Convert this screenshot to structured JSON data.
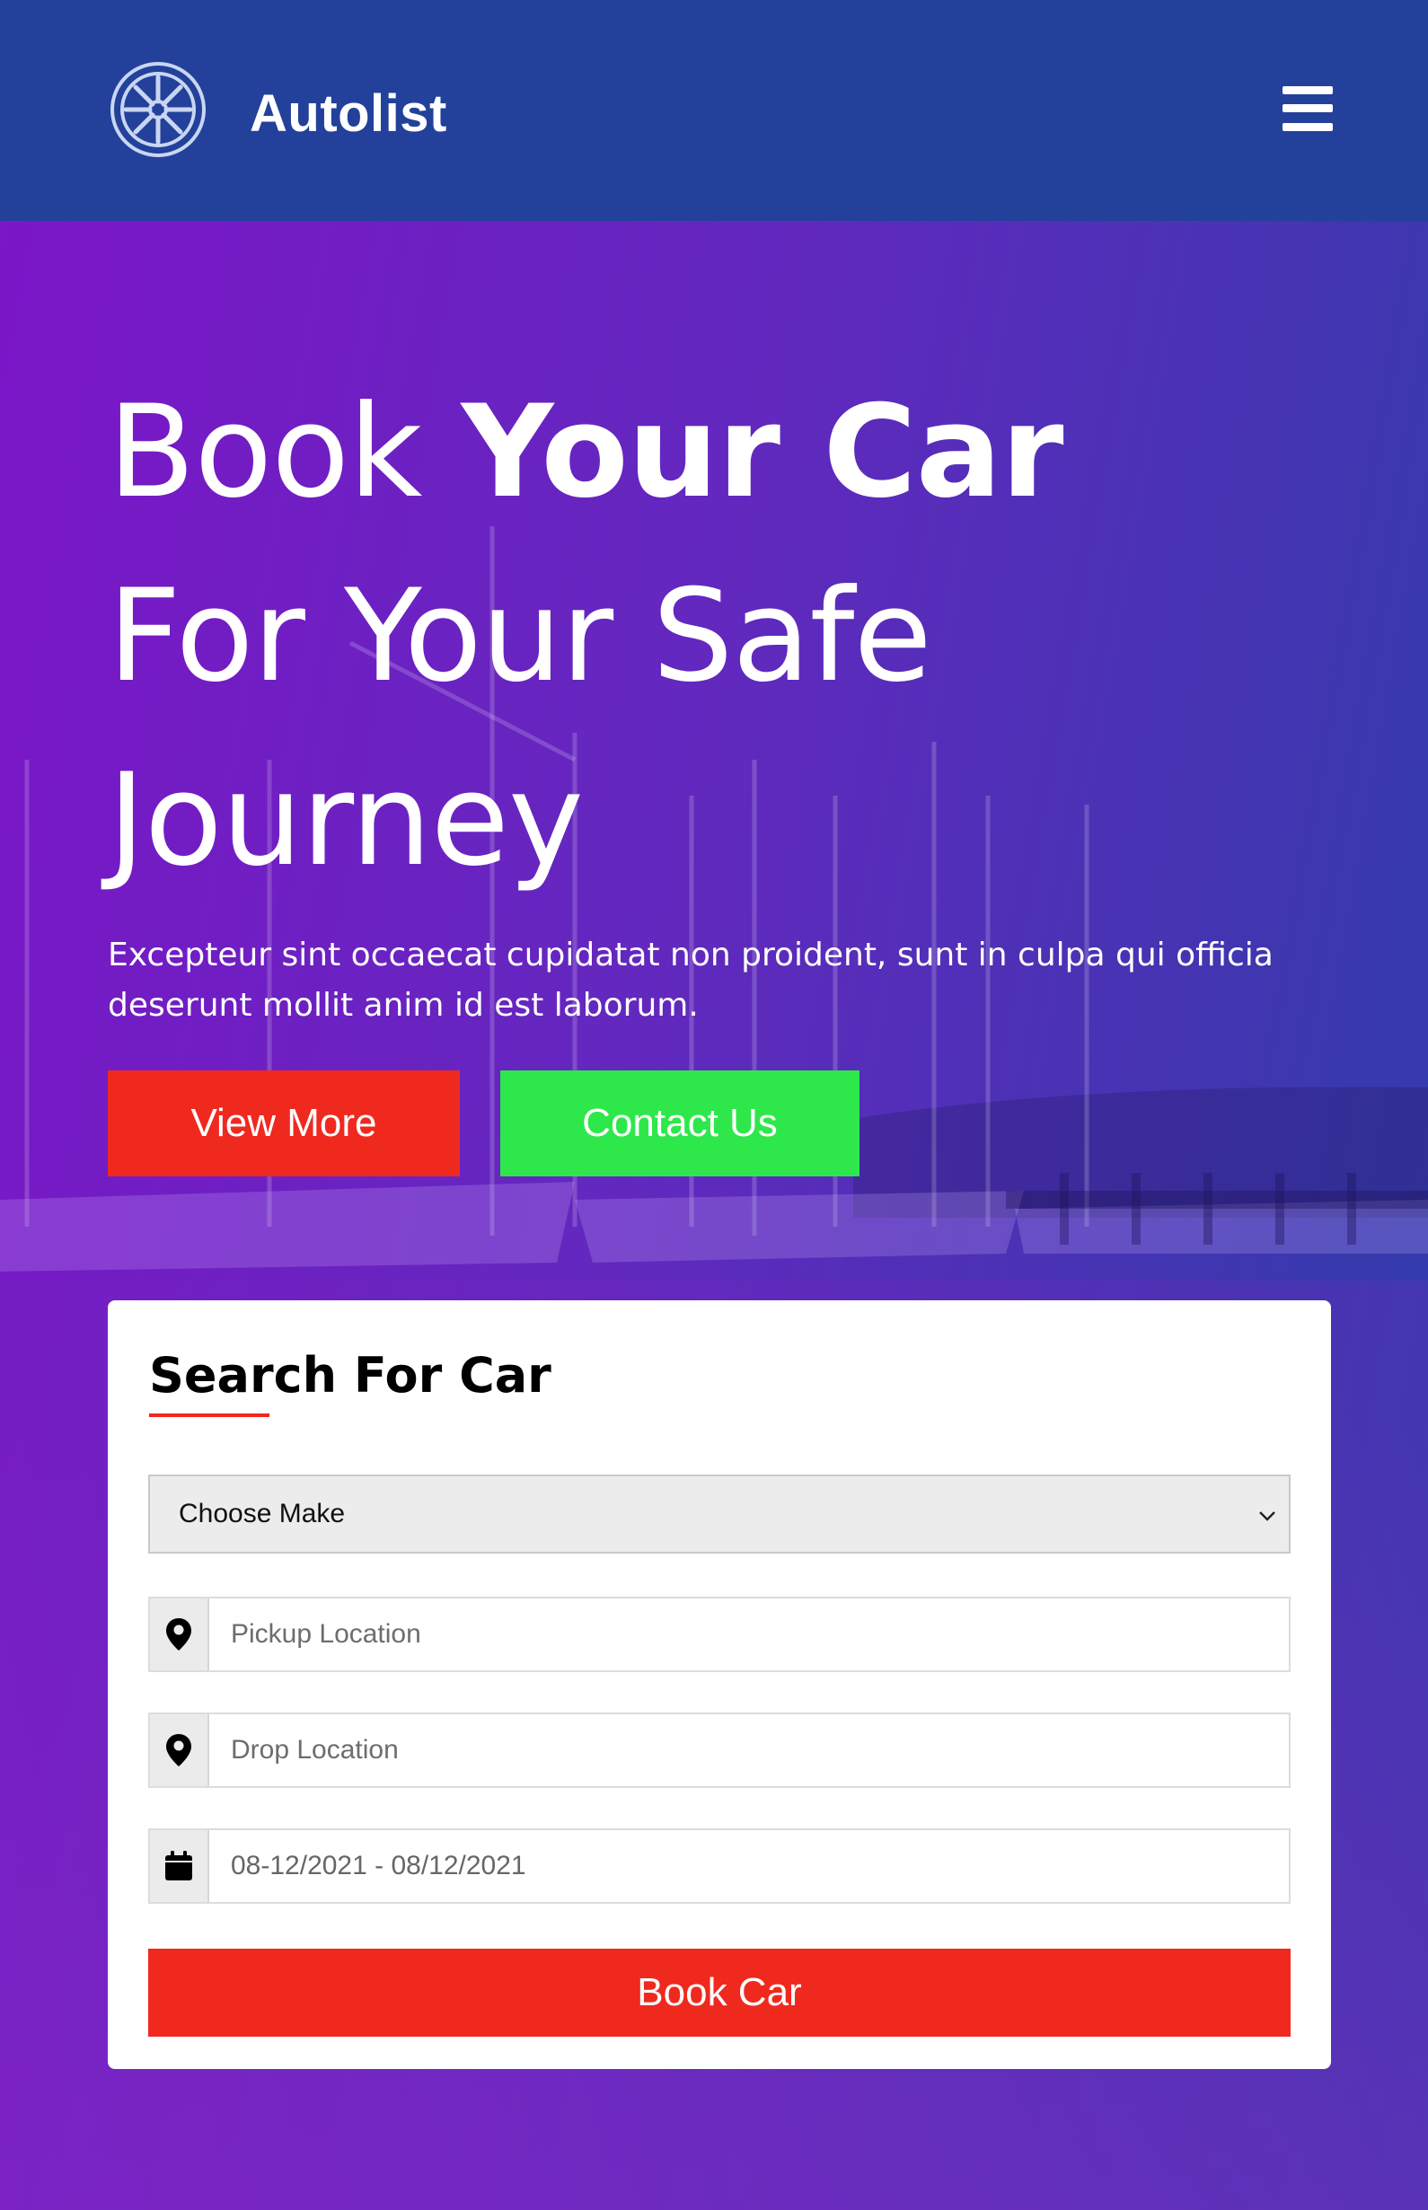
{
  "header": {
    "brand": "Autolist",
    "logo_icon": "wheel-icon",
    "menu_icon": "hamburger-icon",
    "background": "#23419b"
  },
  "hero": {
    "headline_light_1": "Book ",
    "headline_bold": "Your Car",
    "headline_line_2": "For Your Safe",
    "headline_line_3": "Journey",
    "lead": "Excepteur sint occaecat cupidatat non proident, sunt in culpa qui officia deserunt mollit anim id est laborum.",
    "view_more_label": "View More",
    "contact_label": "Contact Us",
    "colors": {
      "view_more": "#f0291f",
      "contact": "#2ee84b"
    }
  },
  "search": {
    "title": "Search For Car",
    "make_selected": "Choose Make",
    "pickup_placeholder": "Pickup Location",
    "drop_placeholder": "Drop Location",
    "date_value": "08-12/2021 - 08/12/2021",
    "book_label": "Book Car",
    "icons": [
      "map-pin-icon",
      "map-pin-icon",
      "calendar-icon",
      "chevron-down-icon"
    ],
    "accent": "#f0291f"
  }
}
